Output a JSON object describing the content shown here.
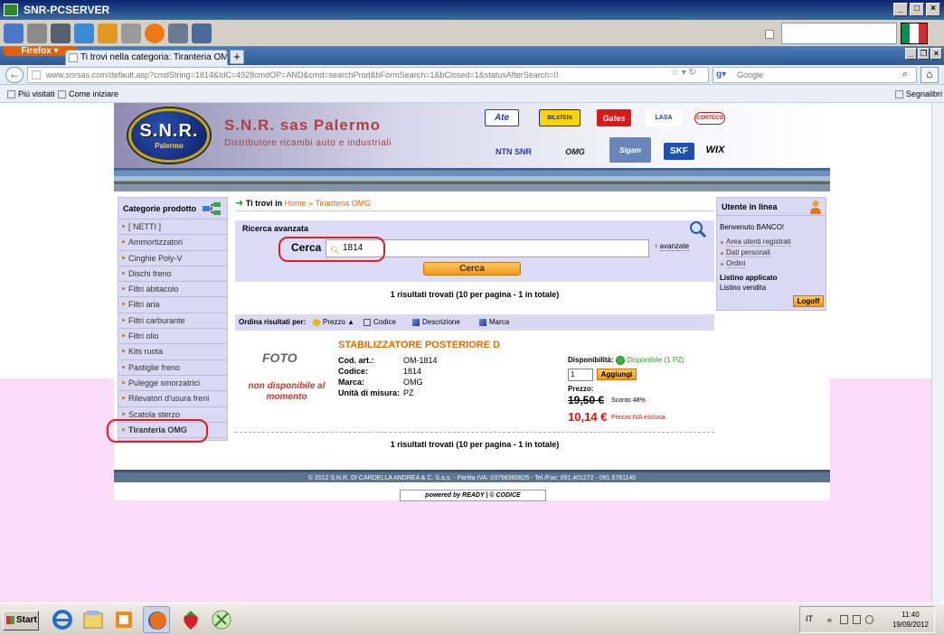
{
  "rdp": {
    "title": "SNR-PCSERVER",
    "tools": [
      "monitor-icon",
      "remote-icon",
      "tools-icon",
      "refresh-icon",
      "windows-icon",
      "drive-icon",
      "alert-icon",
      "disconnect-icon",
      "fullscreen-icon"
    ],
    "flag_colors": [
      "#009246",
      "#ffffff",
      "#ce2b37"
    ]
  },
  "firefox": {
    "menu_label": "Firefox",
    "tab_title": "Ti trovi nella categoria: Tiranteria OMG (Hom...",
    "new_tab": "+",
    "url": "www.snrsas.com/default.asp?cmdString=1814&IdC=4928cmdOP=AND&cmd=searchProd&bFormSearch=1&bClosed=1&statusAfterSearch=0",
    "search_placeholder": "Google",
    "bookmarks": [
      "Più visitati",
      "Come iniziare"
    ],
    "bookmarks_right": "Segnalibri"
  },
  "header": {
    "logo_main": "S.N.R.",
    "logo_sub": "Palermo",
    "title": "S.N.R. sas Palermo",
    "subtitle": "Distributore ricambi auto e industriali",
    "brands": [
      "Ate",
      "BILSTEIN",
      "Gates",
      "LASA",
      "CORTECO",
      "NTN SNR",
      "OMG",
      "Sigam",
      "SKF",
      "WIX"
    ]
  },
  "sidebar": {
    "title": "Categorie prodotto",
    "items": [
      "[ NETTI ]",
      "Ammortizzatori",
      "Cinghie Poly-V",
      "Dischi freno",
      "Filtri abitacolo",
      "Filtri aria",
      "Filtri carburante",
      "Filtri olio",
      "Kits ruota",
      "Pastiglie freno",
      "Pulegge smorzatrici",
      "Rilevatori d'usura freni",
      "Scatola sterzo",
      "Tiranteria OMG"
    ]
  },
  "breadcrumb": {
    "prefix": "Ti trovi in",
    "home": "Home",
    "sep": "»",
    "current": "Tiranteria OMG"
  },
  "search": {
    "title": "Ricerca avanzata",
    "label": "Cerca",
    "value": "1814",
    "advanced": "avanzate",
    "button": "Cerca"
  },
  "results": {
    "summary": "1 risultati trovati (10 per pagina - 1 in totale)"
  },
  "sort": {
    "label": "Ordina risultati per:",
    "options": [
      "Prezzo",
      "Codice",
      "Descrizione",
      "Marca"
    ]
  },
  "product": {
    "foto": "FOTO",
    "no_image": "non disponibile al momento",
    "title": "STABILIZZATORE POSTERIORE D",
    "specs": [
      {
        "k": "Cod. art.:",
        "v": "OM-1814"
      },
      {
        "k": "Codice:",
        "v": "1814"
      },
      {
        "k": "Marca:",
        "v": "OMG"
      },
      {
        "k": "Unità di misura:",
        "v": "PZ"
      }
    ],
    "availability_label": "Disponibilità:",
    "availability": "Disponibile (1 PZ)",
    "qty": "1",
    "add_button": "Aggiungi",
    "price_label": "Prezzo:",
    "old_price": "19,50 €",
    "discount": "Sconto 48%",
    "new_price": "10,14 €",
    "vat_note": "Prezzo IVA esclusa"
  },
  "user": {
    "title": "Utente in linea",
    "welcome": "Benvenuto BANCO!",
    "links": [
      "Area utenti registrati",
      "Dati personali",
      "Ordini"
    ],
    "pricelist_label": "Listino applicato",
    "pricelist": "Listino vendita",
    "logoff": "Logoff"
  },
  "footer": {
    "copyright": "© 2012 S.N.R. DI CARDELLA ANDREA & C. S.a.s. - Partita IVA: 03798360826 - Tel./Fax: 091.401272 - 091.6761140",
    "powered": "powered by READY | © CODICE"
  },
  "taskbar": {
    "start": "Start",
    "lang": "IT",
    "time": "11:40",
    "date": "19/09/2012"
  }
}
